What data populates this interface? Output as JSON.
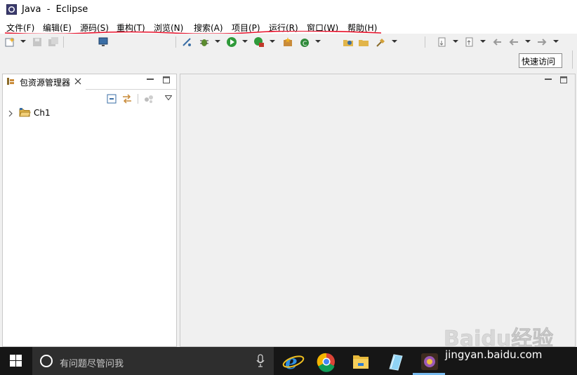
{
  "window": {
    "title": "Java  -  Eclipse"
  },
  "menu": [
    {
      "label": "文件(F)"
    },
    {
      "label": "编辑(E)"
    },
    {
      "label": "源码(S)"
    },
    {
      "label": "重构(T)"
    },
    {
      "label": "浏览(N)"
    },
    {
      "label": "搜索(A)"
    },
    {
      "label": "项目(P)"
    },
    {
      "label": "运行(R)"
    },
    {
      "label": "窗口(W)"
    },
    {
      "label": "帮助(H)"
    }
  ],
  "toolbar": {
    "quick_access": "快速访问"
  },
  "package_explorer": {
    "title": "包资源管理器",
    "items": [
      {
        "label": "Ch1"
      }
    ]
  },
  "taskbar": {
    "search_placeholder": "有问题尽管问我"
  },
  "watermark": {
    "brand_text": "Baidu经验",
    "url": "jingyan.baidu.com"
  },
  "colors": {
    "annotation_underline": "#e8102a",
    "taskbar": "#161616",
    "toolbar": "#f0f0f0"
  }
}
